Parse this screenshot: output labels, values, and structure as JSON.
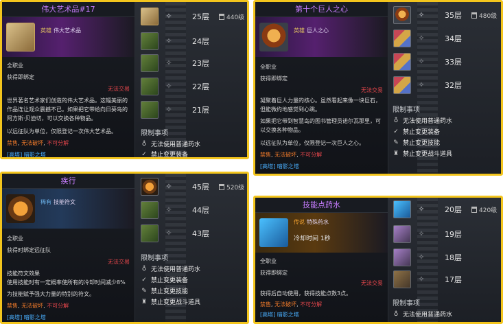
{
  "panel1": {
    "title": "伟大艺术品#17",
    "grade": "英雄",
    "grade_name": "伟大艺术品",
    "lines": [
      "全职业",
      "获得即绑定",
      "无法交易",
      "世界著名艺术家们创造的伟大艺术品。这幅美丽的作品连让观众震撼不已。如果把它带给向日葵岛的阿方斯·贝迪切，可以交换各种物品。",
      "以远征队为单位，仅限登记一次伟大艺术品。"
    ],
    "flags": [
      "禁售",
      "无法破坏",
      "不可分解"
    ],
    "tag": "[高塔] 暗影之塔",
    "floors": [
      {
        "label": "25层",
        "icon": "art-painting-icon",
        "cap": "440级"
      },
      {
        "label": "24层",
        "icon": "green-box-icon"
      },
      {
        "label": "23层",
        "icon": "green-box-icon"
      },
      {
        "label": "22层",
        "icon": "green-box-icon"
      },
      {
        "label": "21层",
        "icon": "green-box-icon"
      }
    ],
    "restr_title": "限制事项",
    "restrictions": [
      "无法使用普通药水",
      "禁止变更装备"
    ]
  },
  "panel2": {
    "title": "第十个巨人之心",
    "grade": "英雄",
    "grade_name": "巨人之心",
    "lines": [
      "全职业",
      "获得即绑定",
      "无法交易",
      "凝聚着巨人力量的核心。虽然看起来像一块巨石，但能微约地感觉到心跳。",
      "如果把它带到智慧岛的图书管理员诺尔瓦那里，可以交换各种物品。",
      "以远征队为单位，仅限登记一次巨人之心。"
    ],
    "flags": [
      "禁售",
      "无法破坏",
      "不可分解"
    ],
    "tag": "[高塔] 暗影之塔",
    "floors": [
      {
        "label": "35层",
        "icon": "shield-icon",
        "cap": "480级"
      },
      {
        "label": "34层",
        "icon": "cards-icon"
      },
      {
        "label": "33层",
        "icon": "cards-icon"
      },
      {
        "label": "32层",
        "icon": "cards-icon"
      }
    ],
    "restr_title": "限制事项",
    "restrictions": [
      "无法使用普通药水",
      "禁止变更装备",
      "禁止变更技能",
      "禁止变更战斗道具"
    ]
  },
  "panel3": {
    "title": "疾行",
    "grade": "稀有",
    "grade_name": "技能符文",
    "lines": [
      "全职业",
      "获得时绑定远征队",
      "无法交易",
      "技能符文效果",
      "使用技能时有一定概率使所有的冷却时间减少8%",
      "为技能赋予强大力量的特别的符文。"
    ],
    "flags": [
      "禁售",
      "无法破坏",
      "不可分解"
    ],
    "tag": "[高塔] 暗影之塔",
    "floors": [
      {
        "label": "45层",
        "icon": "rune-icon",
        "cap": "520级"
      },
      {
        "label": "44层",
        "icon": "green-box-icon"
      },
      {
        "label": "43层",
        "icon": "green-box-icon"
      }
    ],
    "restr_title": "限制事项",
    "restrictions": [
      "无法使用普通药水",
      "禁止变更装备",
      "禁止变更技能",
      "禁止变更战斗道具"
    ]
  },
  "panel4": {
    "title": "技能点药水",
    "grade": "传说",
    "grade_name": "特殊药水",
    "cooldown": "冷却时间 1秒",
    "lines": [
      "全职业",
      "获得即绑定",
      "无法交易",
      "获得后自动使用，获得技能点数3点。"
    ],
    "flags": [
      "禁售",
      "无法破坏",
      "不可分解"
    ],
    "tag": "[高塔] 暗影之塔",
    "floors": [
      {
        "label": "20层",
        "icon": "potion-icon",
        "cap": "420级"
      },
      {
        "label": "19层",
        "icon": "chest-icon"
      },
      {
        "label": "18层",
        "icon": "chest-icon"
      },
      {
        "label": "17层",
        "icon": "box-icon"
      }
    ],
    "restr_title": "限制事项",
    "restrictions": [
      "无法使用普通药水"
    ]
  }
}
